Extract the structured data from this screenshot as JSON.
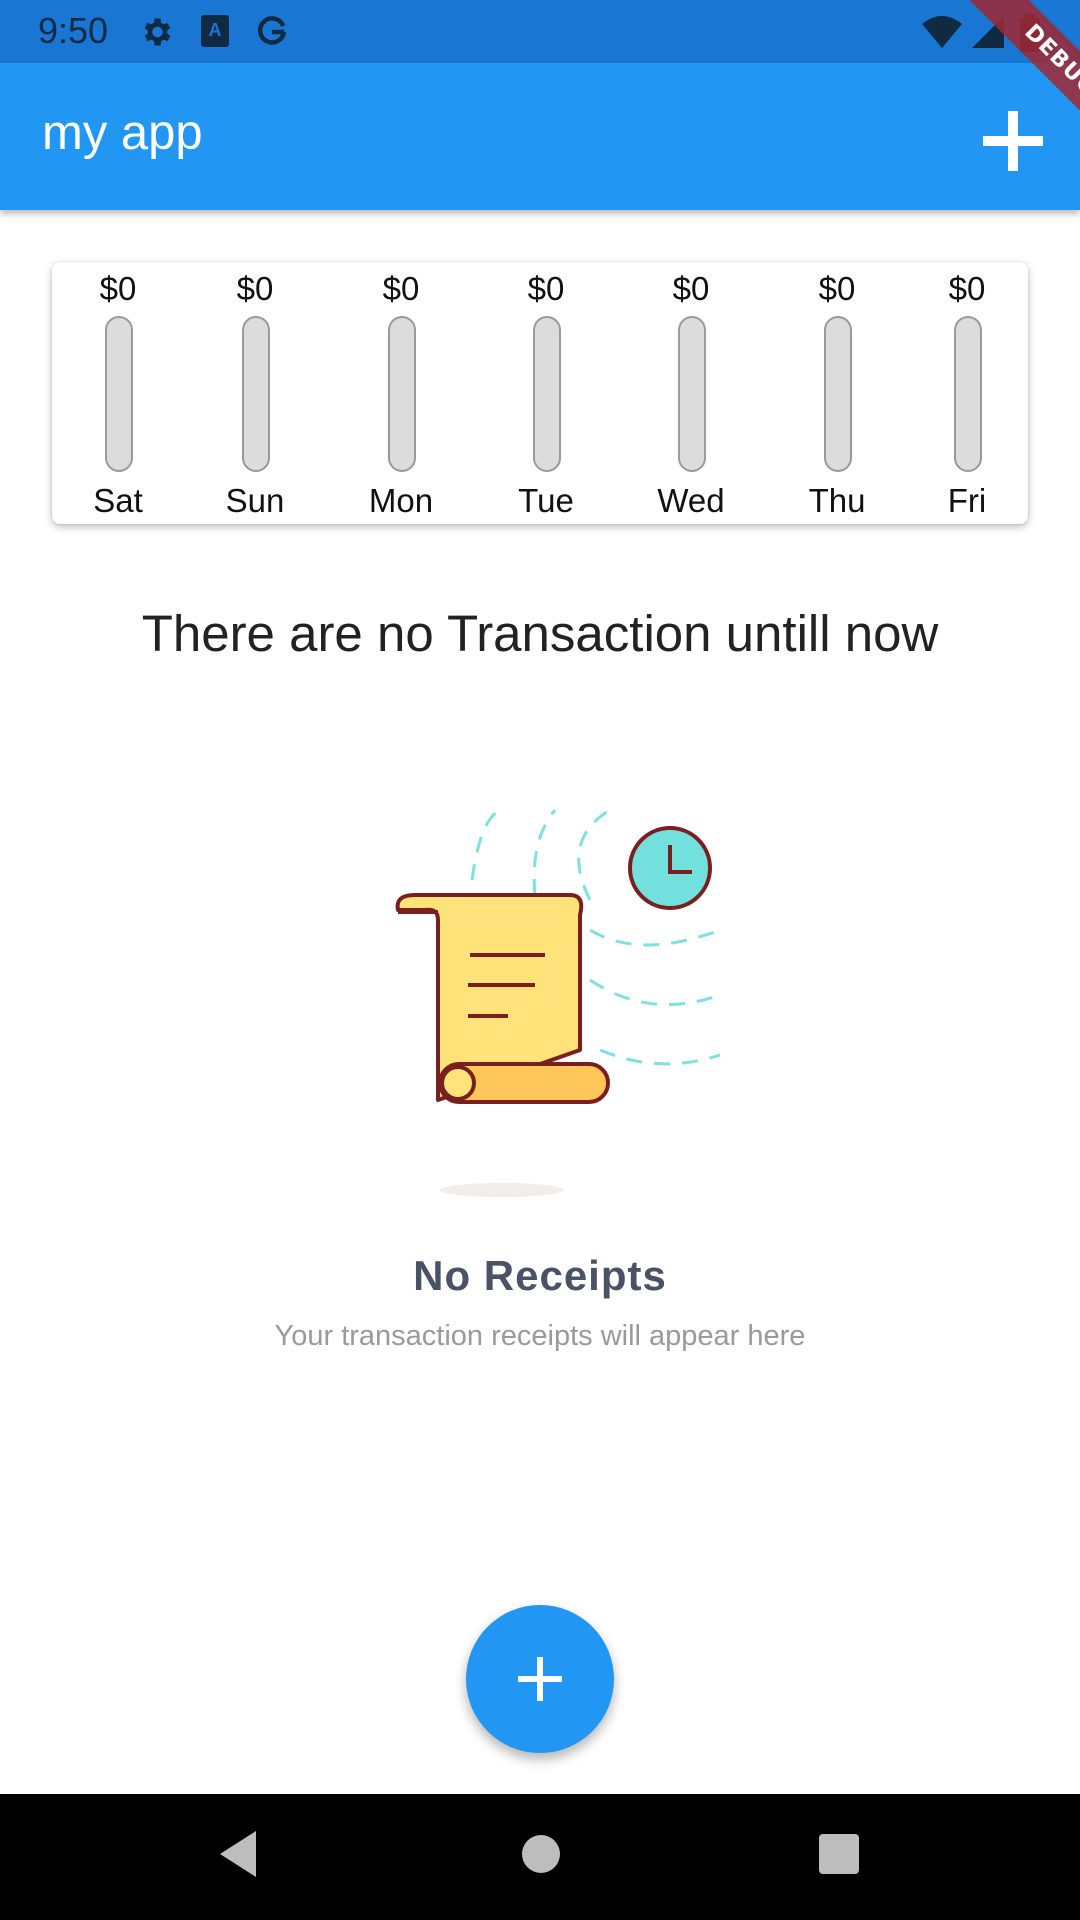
{
  "status_bar": {
    "time": "9:50",
    "icons": [
      "gear-icon",
      "keyboard-a-icon",
      "google-icon",
      "wifi-icon",
      "signal-icon",
      "battery-icon"
    ],
    "color": "#1976D2"
  },
  "app_bar": {
    "title": "my app",
    "action_icon": "plus-icon",
    "color": "#2196F3"
  },
  "debug_banner": {
    "label": "DEBUG"
  },
  "chart": {
    "days": [
      {
        "label": "Sat",
        "amount": "$0",
        "fill_fraction": 0
      },
      {
        "label": "Sun",
        "amount": "$0",
        "fill_fraction": 0
      },
      {
        "label": "Mon",
        "amount": "$0",
        "fill_fraction": 0
      },
      {
        "label": "Tue",
        "amount": "$0",
        "fill_fraction": 0
      },
      {
        "label": "Wed",
        "amount": "$0",
        "fill_fraction": 0
      },
      {
        "label": "Thu",
        "amount": "$0",
        "fill_fraction": 0
      },
      {
        "label": "Fri",
        "amount": "$0",
        "fill_fraction": 0
      }
    ],
    "bar_fill_color": "#2196F3",
    "track_color": "#dcdcdc"
  },
  "empty_state": {
    "title": "There are no Transaction untill now",
    "illustration_icon": "receipt-scroll-icon",
    "heading": "No Receipts",
    "subtitle": "Your transaction receipts will appear here"
  },
  "fab": {
    "icon": "plus-icon",
    "color": "#2196F3"
  },
  "nav_bar": {
    "icons": [
      "back-icon",
      "home-icon",
      "recents-icon"
    ]
  }
}
